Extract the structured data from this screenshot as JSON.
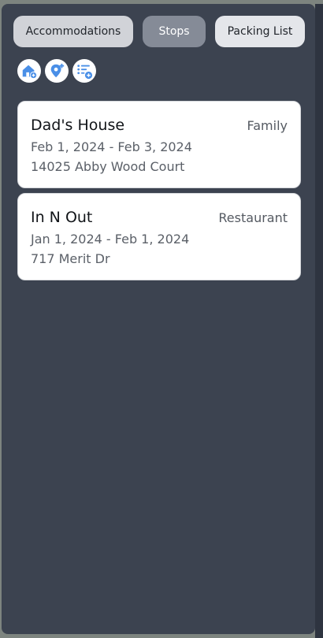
{
  "tabs": [
    {
      "label": "Accommodations",
      "active": false
    },
    {
      "label": "Stops",
      "active": true
    },
    {
      "label": "Packing List",
      "active": false
    }
  ],
  "action_icons": [
    {
      "icon": "add-accommodation-icon",
      "color": "#4a8fe7"
    },
    {
      "icon": "add-location-icon",
      "color": "#4a8fe7"
    },
    {
      "icon": "add-list-item-icon",
      "color": "#4a8fe7"
    }
  ],
  "stops": [
    {
      "name": "Dad's House",
      "category": "Family",
      "dates": "Feb 1, 2024 - Feb 3, 2024",
      "address": "14025 Abby Wood Court"
    },
    {
      "name": "In N Out",
      "category": "Restaurant",
      "dates": "Jan 1, 2024 - Feb 1, 2024",
      "address": "717 Merit Dr"
    }
  ],
  "colors": {
    "panel_bg": "#3c4350",
    "active_tab": "#858b97",
    "accent": "#4a8fe7"
  }
}
